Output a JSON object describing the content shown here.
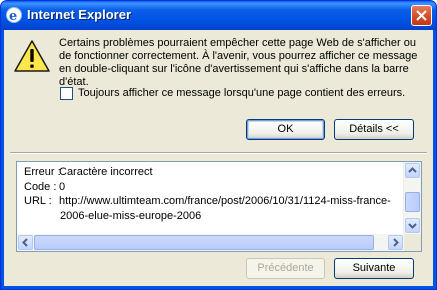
{
  "window": {
    "title": "Internet Explorer"
  },
  "message": "Certains problèmes pourraient empêcher cette page Web de s'afficher ou de fonctionner correctement. À l'avenir, vous pourrez afficher ce message en double-cliquant sur l'icône d'avertissement qui s'affiche dans la barre d'état.",
  "checkbox": {
    "label": "Toujours afficher ce message lorsqu'une page contient des erreurs.",
    "checked": false
  },
  "buttons": {
    "ok": "OK",
    "details": "Détails <<",
    "previous": "Précédente",
    "next": "Suivante"
  },
  "details": {
    "error_key": "Erreur :",
    "error_value": "Caractère incorrect",
    "code_key": "Code :",
    "code_value": "0",
    "url_key": "URL :",
    "url_value_line1": "http://www.ultimteam.com/france/post/2006/10/31/1124-miss-france-",
    "url_value_line2": "2006-elue-miss-europe-2006"
  },
  "colors": {
    "titlebar": "#0054e3",
    "dialog_bg": "#ece9d8",
    "close_button": "#d24a25"
  }
}
